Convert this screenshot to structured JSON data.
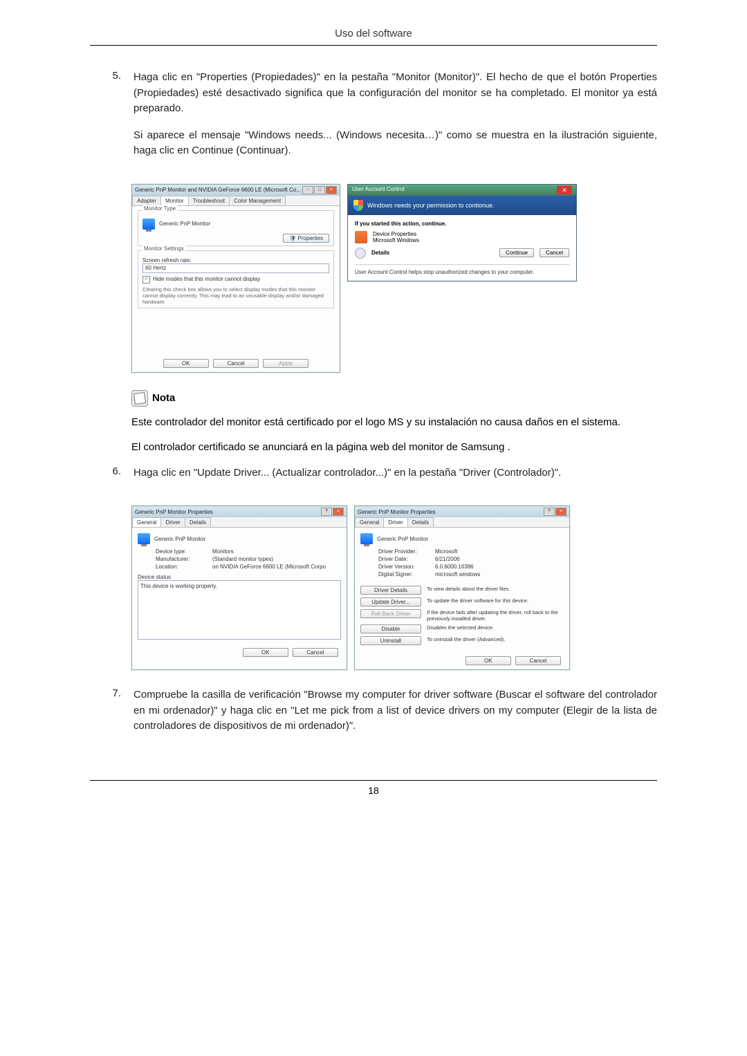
{
  "header": {
    "title": "Uso del software"
  },
  "steps": {
    "s5": {
      "num": "5.",
      "para1": "Haga clic en \"Properties (Propiedades)\" en la pestaña \"Monitor (Monitor)\". El hecho de que el botón Properties (Propiedades) esté desactivado significa que la configuración del monitor se ha completado. El monitor ya está preparado.",
      "para2": "Si aparece el mensaje \"Windows needs... (Windows necesita…)\" como se muestra en la ilustración siguiente, haga clic en Continue (Continuar)."
    },
    "s6": {
      "num": "6.",
      "para1": "Haga clic en \"Update Driver... (Actualizar controlador...)\" en la pestaña \"Driver (Controlador)\"."
    },
    "s7": {
      "num": "7.",
      "para1": "Compruebe la casilla de verificación \"Browse my computer for driver software (Buscar el software del controlador en mi ordenador)\" y haga clic en \"Let me pick from a list of device drivers on my computer (Elegir de la lista de controladores de dispositivos de mi ordenador)\"."
    }
  },
  "dialog1": {
    "title": "Generic PnP Monitor and NVIDIA GeForce 6600 LE (Microsoft Co...",
    "tabs": {
      "adapter": "Adapter",
      "monitor": "Monitor",
      "troubleshoot": "Troubleshoot",
      "color": "Color Management"
    },
    "monitorType": "Monitor Type",
    "monitorName": "Generic PnP Monitor",
    "propertiesBtn": "Properties",
    "monitorSettings": "Monitor Settings",
    "refreshLabel": "Screen refresh rate:",
    "refreshValue": "60 Hertz",
    "hideCheck": "Hide modes that this monitor cannot display",
    "hideDesc": "Clearing this check box allows you to select display modes that this monitor cannot display correctly. This may lead to an unusable display and/or damaged hardware.",
    "ok": "OK",
    "cancel": "Cancel",
    "apply": "Apply"
  },
  "uac": {
    "title": "User Account Control",
    "banner": "Windows needs your permission to contionue.",
    "ifStarted": "If you started this action, continue.",
    "progName": "Device Properties",
    "progPub": "Microsoft Windows",
    "details": "Details",
    "continue": "Continue",
    "cancel": "Cancel",
    "footer": "User Account Control helps stop unauthorized changes to your computer."
  },
  "note": {
    "label": "Nota",
    "p1": "Este controlador del monitor está certificado por el logo MS y su instalación no causa daños en el sistema.",
    "p2": "El controlador certificado se anunciará en la página web del monitor de Samsung ."
  },
  "propGeneral": {
    "title": "Generic PnP Monitor Properties",
    "tabs": {
      "general": "General",
      "driver": "Driver",
      "details": "Details"
    },
    "name": "Generic PnP Monitor",
    "deviceTypeL": "Device type:",
    "deviceTypeV": "Monitors",
    "manufacturerL": "Manufacturer:",
    "manufacturerV": "(Standard monitor types)",
    "locationL": "Location:",
    "locationV": "on NVIDIA GeForce 6600 LE (Microsoft Corpo",
    "statusLabel": "Device status",
    "statusText": "This device is working properly.",
    "ok": "OK",
    "cancel": "Cancel"
  },
  "propDriver": {
    "title": "Generic PnP Monitor Properties",
    "tabs": {
      "general": "General",
      "driver": "Driver",
      "details": "Details"
    },
    "name": "Generic PnP Monitor",
    "providerL": "Driver Provider:",
    "providerV": "Microsoft",
    "dateL": "Driver Date:",
    "dateV": "6/21/2006",
    "versionL": "Driver Version:",
    "versionV": "6.0.6000.16386",
    "signerL": "Digital Signer:",
    "signerV": "microsoft windows",
    "driverDetails": "Driver Details",
    "driverDetailsDesc": "To view details about the driver files.",
    "updateDriver": "Update Driver...",
    "updateDriverDesc": "To update the driver software for this device.",
    "rollback": "Roll Back Driver",
    "rollbackDesc": "If the device fails after updating the driver, roll back to the previously installed driver.",
    "disable": "Disable",
    "disableDesc": "Disables the selected device.",
    "uninstall": "Uninstall",
    "uninstallDesc": "To uninstall the driver (Advanced).",
    "ok": "OK",
    "cancel": "Cancel"
  },
  "pageNum": "18"
}
